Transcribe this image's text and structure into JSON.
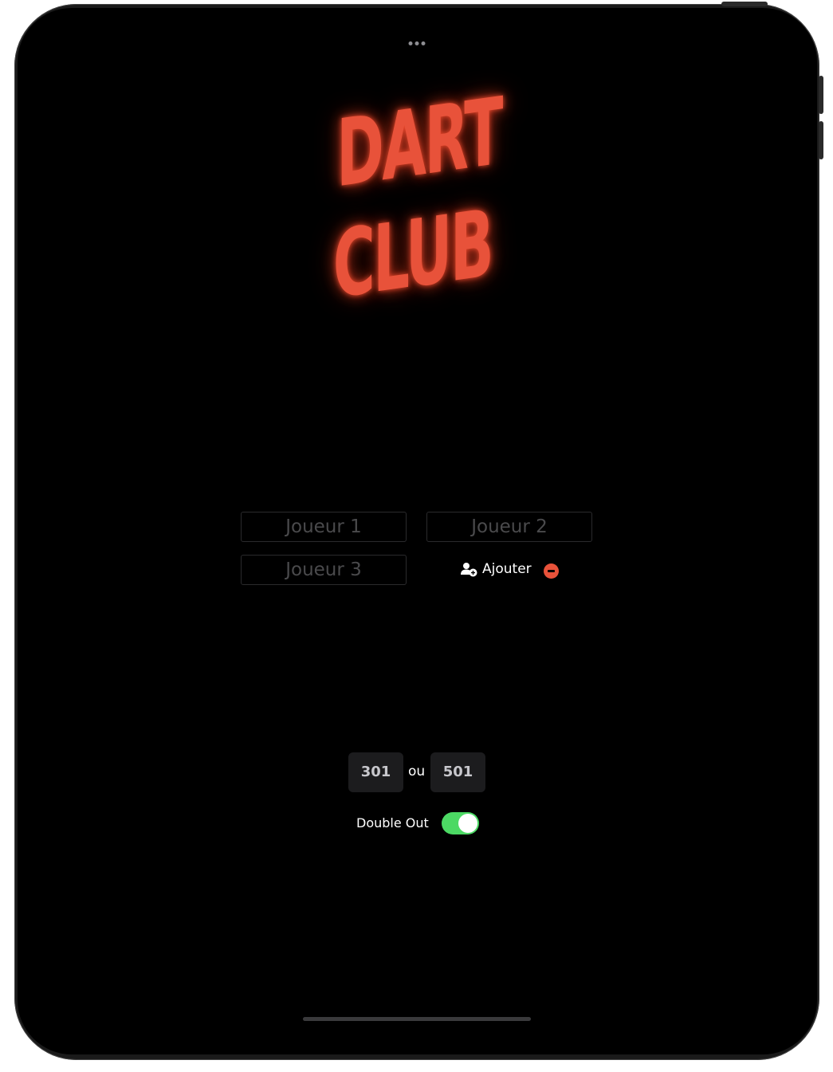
{
  "logo": {
    "line1": "DART",
    "line2": "CLUB",
    "color": "#e8523a"
  },
  "players": [
    {
      "placeholder": "Joueur 1"
    },
    {
      "placeholder": "Joueur 2"
    },
    {
      "placeholder": "Joueur 3"
    }
  ],
  "add_player": {
    "label": "Ajouter",
    "icon": "person-add-icon"
  },
  "remove_player": {
    "icon": "minus-circle-icon",
    "color": "#e8523a"
  },
  "game_mode": {
    "option1": "301",
    "separator": "ou",
    "option2": "501"
  },
  "double_out": {
    "label": "Double Out",
    "enabled": true,
    "color": "#4cd964"
  }
}
